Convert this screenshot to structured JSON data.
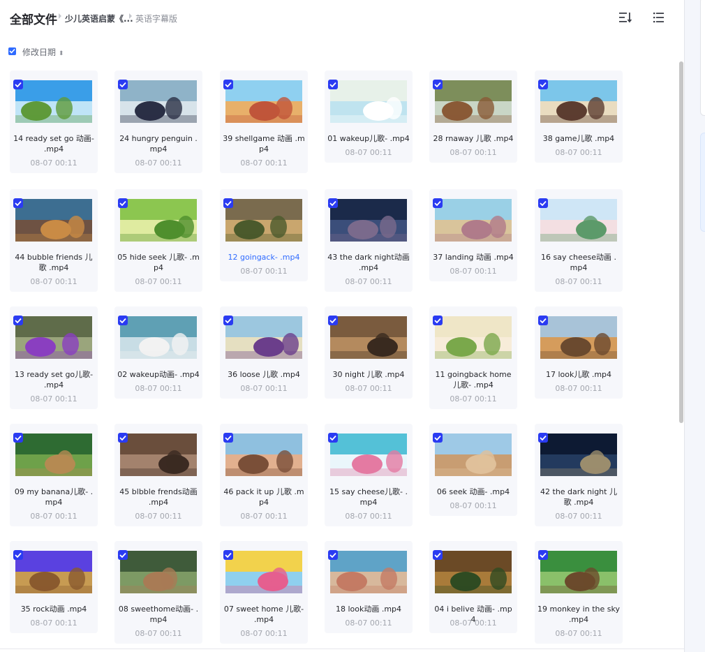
{
  "breadcrumb": {
    "root": "全部文件",
    "folder": "少儿英语启蒙《...",
    "current": "英语字幕版"
  },
  "toolbar": {
    "sort_icon": "sort-list-icon",
    "view_icon": "list-view-icon"
  },
  "sort": {
    "label": "修改日期",
    "arrow": "⬍",
    "select_all_checked": true
  },
  "colors": {
    "accent": "#2f6bff",
    "checkbox": "#2a3bf2",
    "card_bg": "#f6f7fb",
    "muted_text": "#a3a6ae"
  },
  "files": [
    {
      "name": "14 ready set go 动画- .mp4",
      "date": "08-07 00:11"
    },
    {
      "name": "24 hungry penguin .mp4",
      "date": "08-07 00:11"
    },
    {
      "name": "39 shellgame 动画 .mp4",
      "date": "08-07 00:11"
    },
    {
      "name": "01 wakeup儿歌- .mp4",
      "date": "08-07 00:11"
    },
    {
      "name": "28 rnaway 儿歌 .mp4",
      "date": "08-07 00:11"
    },
    {
      "name": "38 game儿歌 .mp4",
      "date": "08-07 00:11"
    },
    {
      "name": "44 bubble friends 儿歌 .mp4",
      "date": "08-07 00:11"
    },
    {
      "name": "05 hide seek 儿歌- .mp4",
      "date": "08-07 00:11"
    },
    {
      "name": "12 goingack- .mp4",
      "date": "08-07 00:11"
    },
    {
      "name": "43 the dark night动画 .mp4",
      "date": "08-07 00:11"
    },
    {
      "name": "37 landing 动画 .mp4",
      "date": "08-07 00:11"
    },
    {
      "name": "16 say cheese动画 .mp4",
      "date": "08-07 00:11"
    },
    {
      "name": "13 ready set go儿歌- .mp4",
      "date": "08-07 00:11"
    },
    {
      "name": "02 wakeup动画- .mp4",
      "date": "08-07 00:11"
    },
    {
      "name": "36 loose 儿歌 .mp4",
      "date": "08-07 00:11"
    },
    {
      "name": "30 night 儿歌 .mp4",
      "date": "08-07 00:11"
    },
    {
      "name": "11 goingback home儿歌- .mp4",
      "date": "08-07 00:11"
    },
    {
      "name": "17 look儿歌 .mp4",
      "date": "08-07 00:11"
    },
    {
      "name": "09 my banana儿歌- .mp4",
      "date": "08-07 00:11"
    },
    {
      "name": "45 blbble frends动画 .mp4",
      "date": "08-07 00:11"
    },
    {
      "name": "46 pack it up 儿歌 .mp4",
      "date": "08-07 00:11"
    },
    {
      "name": "15 say cheese儿歌- .mp4",
      "date": "08-07 00:11"
    },
    {
      "name": "06 seek 动画- .mp4",
      "date": "08-07 00:11"
    },
    {
      "name": "42 the dark night 儿歌 .mp4",
      "date": "08-07 00:11"
    },
    {
      "name": "35 rock动画 .mp4",
      "date": "08-07 00:11"
    },
    {
      "name": "08 sweethome动画- .mp4",
      "date": "08-07 00:11"
    },
    {
      "name": "07 sweet home 儿歌- .mp4",
      "date": "08-07 00:11"
    },
    {
      "name": "18 look动画 .mp4",
      "date": "08-07 00:11"
    },
    {
      "name": "04 i belive 动画- .mp4",
      "date": "08-07 00:11"
    },
    {
      "name": "19 monkey in the sky .mp4",
      "date": "08-07 00:11"
    }
  ]
}
